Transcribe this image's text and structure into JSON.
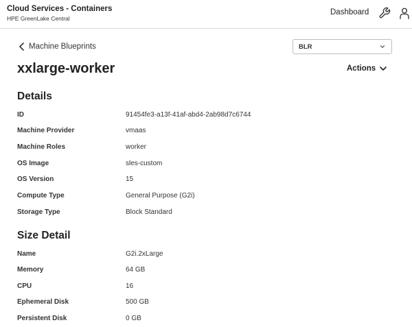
{
  "header": {
    "title": "Cloud Services - Containers",
    "subtitle": "HPE GreenLake Central",
    "dashboard_label": "Dashboard",
    "icons": [
      "wrench-icon",
      "user-icon"
    ]
  },
  "breadcrumb": {
    "back_label": "Machine Blueprints"
  },
  "region_select": {
    "value": "BLR"
  },
  "page": {
    "title": "xxlarge-worker",
    "actions_label": "Actions"
  },
  "details": {
    "heading": "Details",
    "rows": [
      {
        "label": "ID",
        "value": "91454fe3-a13f-41af-abd4-2ab98d7c6744"
      },
      {
        "label": "Machine Provider",
        "value": "vmaas"
      },
      {
        "label": "Machine Roles",
        "value": "worker"
      },
      {
        "label": "OS Image",
        "value": "sles-custom"
      },
      {
        "label": "OS Version",
        "value": "15"
      },
      {
        "label": "Compute Type",
        "value": "General Purpose (G2i)"
      },
      {
        "label": "Storage Type",
        "value": "Block Standard"
      }
    ]
  },
  "size_detail": {
    "heading": "Size Detail",
    "rows": [
      {
        "label": "Name",
        "value": "G2i.2xLarge"
      },
      {
        "label": "Memory",
        "value": "64 GB"
      },
      {
        "label": "CPU",
        "value": "16"
      },
      {
        "label": "Ephemeral Disk",
        "value": "500 GB"
      },
      {
        "label": "Persistent Disk",
        "value": "0 GB"
      }
    ]
  }
}
